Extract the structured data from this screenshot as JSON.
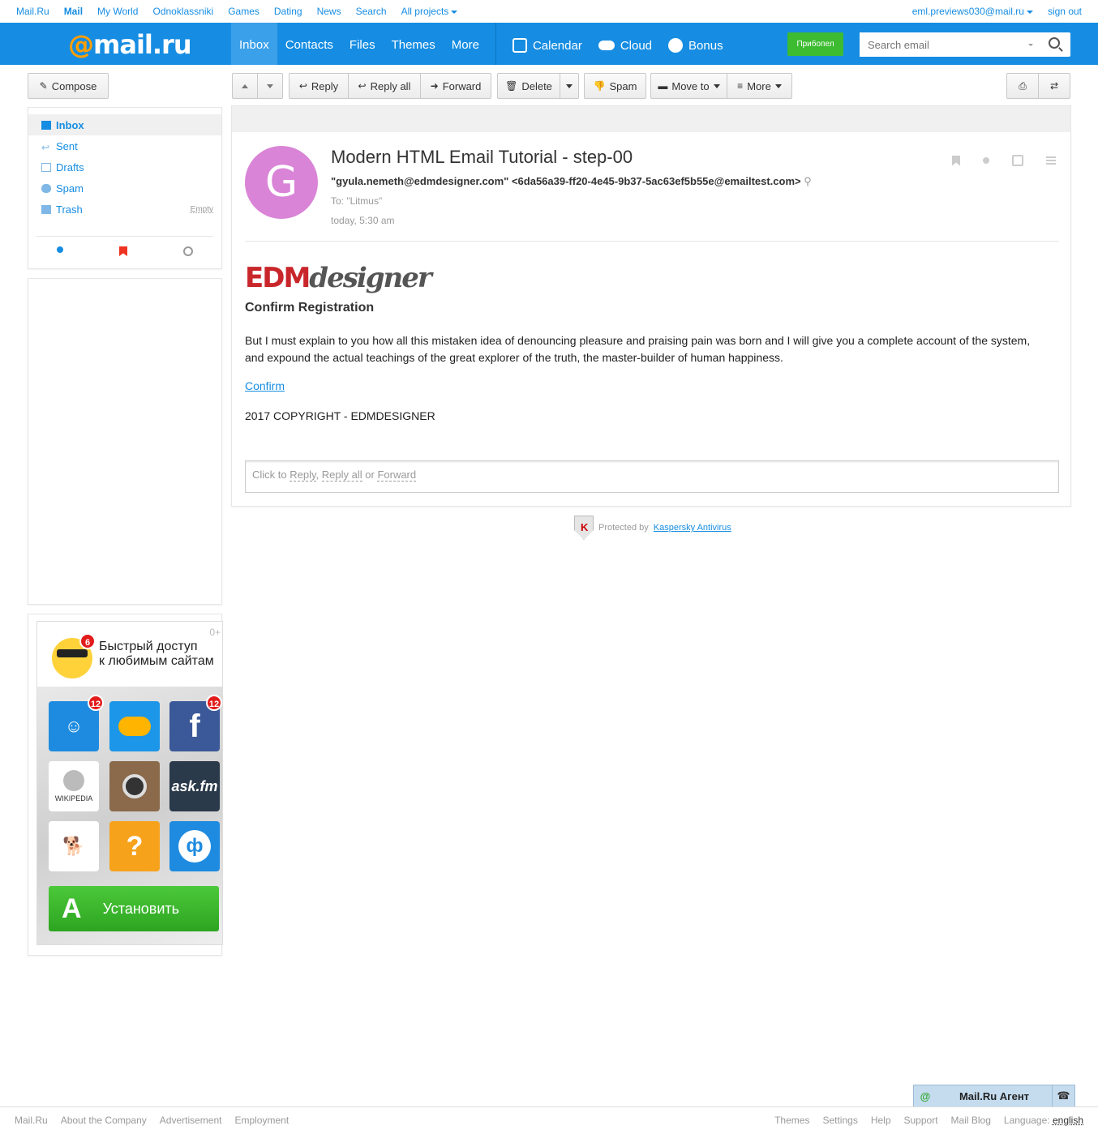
{
  "portal": {
    "links": [
      "Mail.Ru",
      "Mail",
      "My World",
      "Odnoklassniki",
      "Games",
      "Dating",
      "News",
      "Search",
      "All projects"
    ],
    "user": "eml.previews030@mail.ru",
    "signout": "sign out"
  },
  "header": {
    "logo_at": "@",
    "logo_text": "mail.ru",
    "nav": [
      "Inbox",
      "Contacts",
      "Files",
      "Themes",
      "More"
    ],
    "services": [
      "Calendar",
      "Cloud",
      "Bonus"
    ],
    "promo_button": "Прибопел",
    "search_placeholder": "Search email"
  },
  "toolbar": {
    "compose": "Compose",
    "reply": "Reply",
    "reply_all": "Reply all",
    "forward": "Forward",
    "delete": "Delete",
    "spam": "Spam",
    "move_to": "Move to",
    "more": "More"
  },
  "folders": [
    {
      "label": "Inbox",
      "active": true
    },
    {
      "label": "Sent"
    },
    {
      "label": "Drafts"
    },
    {
      "label": "Spam"
    },
    {
      "label": "Trash",
      "extra": "Empty"
    }
  ],
  "ad": {
    "age": "0+",
    "text_line1": "Быстрый доступ",
    "text_line2": "к любимым сайтам",
    "badge_main": "6",
    "badge_tile": "12",
    "tiles": [
      "ask.fm",
      "WIKIPEDIA"
    ],
    "install": "Установить"
  },
  "message": {
    "avatar_letter": "G",
    "subject": "Modern HTML Email Tutorial - step-00",
    "from": "\"gyula.nemeth@edmdesigner.com\" <6da56a39-ff20-4e45-9b37-5ac63ef5b55e@emailtest.com>",
    "to": "To: \"Litmus\"",
    "date": "today, 5:30 am",
    "logo_red": "EDM",
    "logo_grey": "designer",
    "title": "Confirm Registration",
    "body": "But I must explain to you how all this mistaken idea of denouncing pleasure and praising pain was born and I will give you a complete account of the system, and expound the actual teachings of the great explorer of the truth, the master-builder of human happiness.",
    "link": "Confirm",
    "copyright": "2017 COPYRIGHT - EDMDESIGNER",
    "quick_reply_prefix": "Click to",
    "quick_reply_reply": "Reply",
    "quick_reply_replyall": "Reply all",
    "quick_reply_or": "or",
    "quick_reply_forward": "Forward"
  },
  "kaspersky": {
    "prefix": "Protected by",
    "link": "Kaspersky Antivirus"
  },
  "agent": {
    "label": "Mail.Ru Агент"
  },
  "footer": {
    "left": [
      "Mail.Ru",
      "About the Company",
      "Advertisement",
      "Employment"
    ],
    "right": [
      "Themes",
      "Settings",
      "Help",
      "Support",
      "Mail Blog"
    ],
    "language_label": "Language:",
    "language_value": "english"
  }
}
